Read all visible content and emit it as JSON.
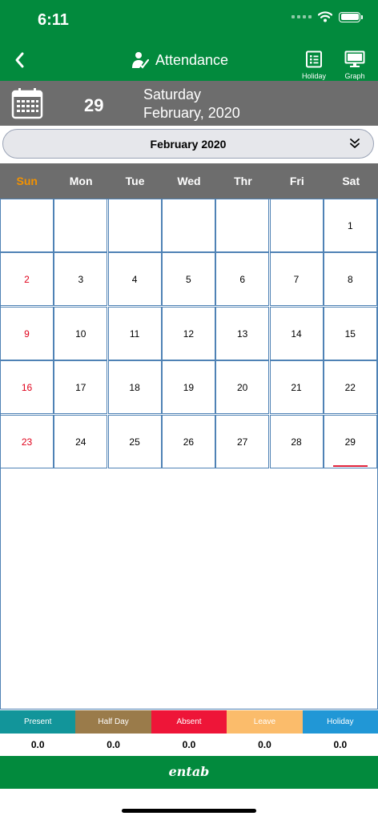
{
  "status": {
    "time": "6:11"
  },
  "header": {
    "title": "Attendance",
    "holiday_label": "Holiday",
    "graph_label": "Graph"
  },
  "date_bar": {
    "day": "29",
    "weekday": "Saturday",
    "month_year": "February, 2020"
  },
  "month_selector": {
    "label": "February 2020"
  },
  "weekdays": [
    "Sun",
    "Mon",
    "Tue",
    "Wed",
    "Thr",
    "Fri",
    "Sat"
  ],
  "calendar": {
    "weeks": [
      [
        "",
        "",
        "",
        "",
        "",
        "",
        "1"
      ],
      [
        "2",
        "3",
        "4",
        "5",
        "6",
        "7",
        "8"
      ],
      [
        "9",
        "10",
        "11",
        "12",
        "13",
        "14",
        "15"
      ],
      [
        "16",
        "17",
        "18",
        "19",
        "20",
        "21",
        "22"
      ],
      [
        "23",
        "24",
        "25",
        "26",
        "27",
        "28",
        "29"
      ]
    ],
    "selected_day": "29"
  },
  "legend": [
    {
      "label": "Present",
      "count": "0.0",
      "color": "#12959a"
    },
    {
      "label": "Half Day",
      "count": "0.0",
      "color": "#9a7b4a"
    },
    {
      "label": "Absent",
      "count": "0.0",
      "color": "#ee1538"
    },
    {
      "label": "Leave",
      "count": "0.0",
      "color": "#fbbc6b"
    },
    {
      "label": "Holiday",
      "count": "0.0",
      "color": "#2197d6"
    }
  ],
  "footer": {
    "logo_text": "entab"
  },
  "colors": {
    "header_green": "#028a3d",
    "bar_gray": "#6d6d6d",
    "sunday_orange": "#f39200",
    "sunday_red": "#e0001a",
    "grid_blue": "#4f82b5"
  }
}
